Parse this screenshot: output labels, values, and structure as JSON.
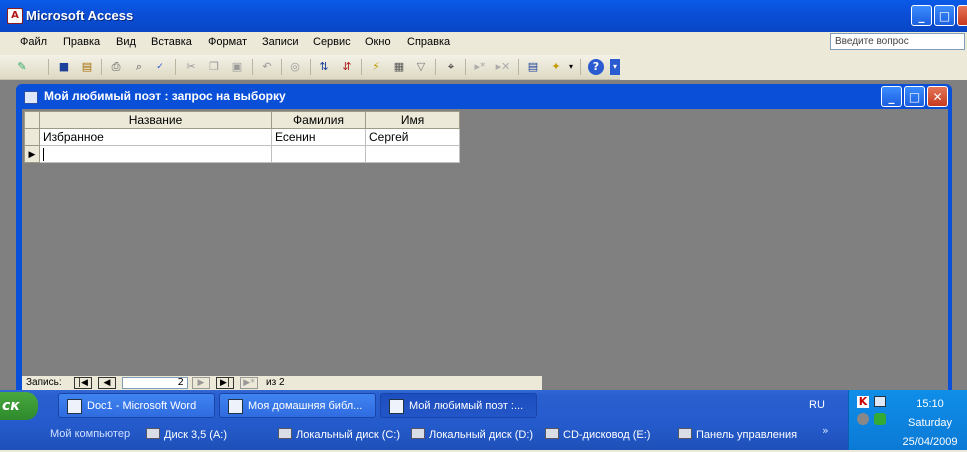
{
  "app": {
    "title": "Microsoft Access",
    "icon_letter": "A"
  },
  "window_buttons": {
    "minimize": "_",
    "restore": "□",
    "close": "✕"
  },
  "menu": {
    "items": [
      "Файл",
      "Правка",
      "Вид",
      "Вставка",
      "Формат",
      "Записи",
      "Сервис",
      "Окно",
      "Справка"
    ],
    "ask_placeholder": "Введите вопрос"
  },
  "toolbar": {
    "icons": [
      "design-view-icon",
      "save-icon",
      "permissions-icon",
      "print-icon",
      "print-preview-icon",
      "spelling-icon",
      "cut-icon",
      "copy-icon",
      "paste-icon",
      "undo-icon",
      "hyperlink-icon",
      "sort-ascending-icon",
      "sort-descending-icon",
      "filter-by-selection-icon",
      "filter-by-form-icon",
      "apply-filter-icon",
      "find-icon",
      "new-record-icon",
      "delete-record-icon",
      "database-window-icon",
      "new-object-icon",
      "help-icon"
    ]
  },
  "query_window": {
    "title": "Мой любимый поэт : запрос на выборку",
    "columns": [
      "Название",
      "Фамилия",
      "Имя"
    ],
    "rows": [
      [
        "Избранное",
        "Есенин",
        "Сергей"
      ]
    ]
  },
  "record_nav": {
    "label": "Запись:",
    "current": "2",
    "of_label": "из 2"
  },
  "taskbar": {
    "start_label": "ск",
    "tasks": [
      {
        "label": "Doc1 - Microsoft Word",
        "active": false
      },
      {
        "label": "Моя домашняя библ...",
        "active": false
      },
      {
        "label": "Мой любимый поэт :...",
        "active": true
      }
    ],
    "quick_links": [
      "Мой компьютер",
      "Диск 3,5 (A:)",
      "Локальный диск (C:)",
      "Локальный диск (D:)",
      "CD-дисковод (E:)",
      "Панель управления"
    ],
    "language": "RU"
  },
  "clock": {
    "time": "15:10",
    "day": "Saturday",
    "date": "25/04/2009"
  }
}
